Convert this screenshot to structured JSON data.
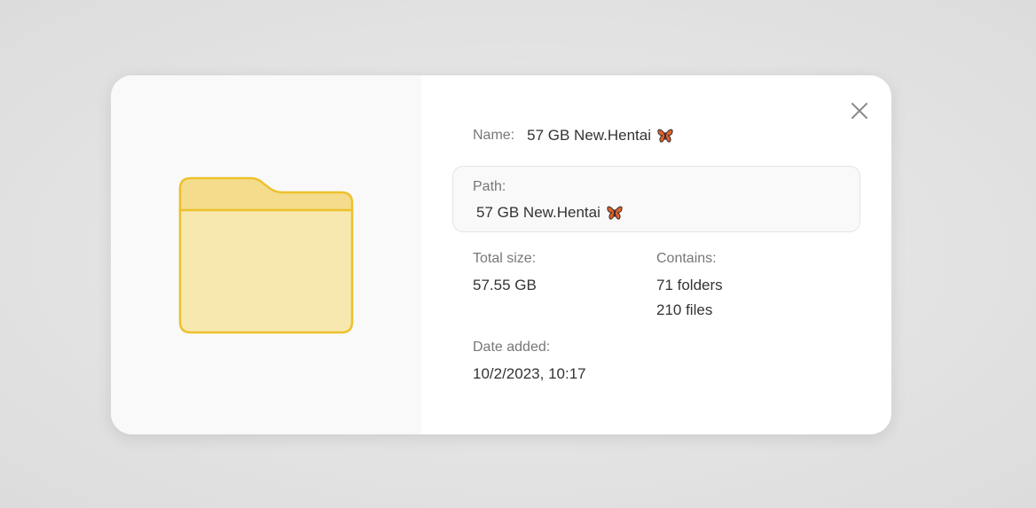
{
  "dialog": {
    "name_label": "Name:",
    "name_value": "57 GB New.Hentai",
    "path_label": "Path:",
    "path_value": "57 GB New.Hentai",
    "total_size_label": "Total size:",
    "total_size_value": "57.55 GB",
    "contains_label": "Contains:",
    "contains_folders": "71 folders",
    "contains_files": "210 files",
    "date_added_label": "Date added:",
    "date_added_value": "10/2/2023, 10:17"
  },
  "icons": {
    "preview": "folder-icon",
    "emoji": "butterfly-icon",
    "close": "close-icon"
  },
  "colors": {
    "folder_fill": "#f7e8b0",
    "folder_tab": "#f4dc8c",
    "folder_stroke": "#ecc12c",
    "butterfly": "#e0622a"
  }
}
